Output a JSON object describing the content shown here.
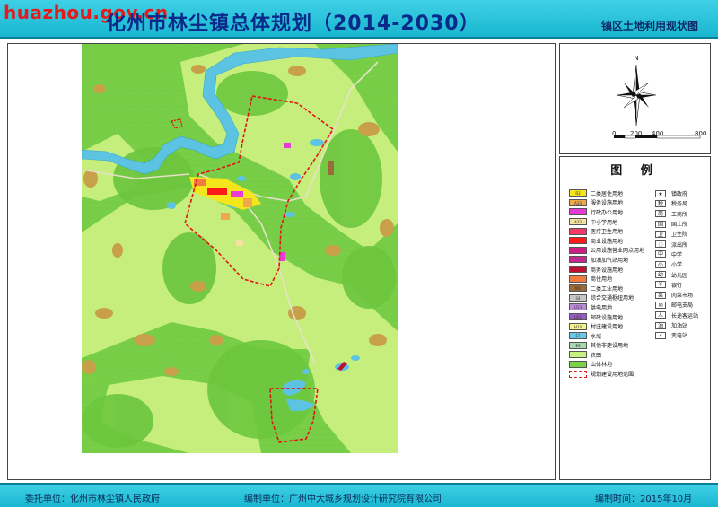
{
  "header": {
    "watermark": "huazhou.gov.cn",
    "title": "化州市林尘镇总体规划（2014-2030）",
    "subtitle": "镇区土地利用现状图"
  },
  "compass": {
    "north_label": "N",
    "scale": [
      "0",
      "200",
      "400",
      "800"
    ]
  },
  "legend": {
    "title": "图  例",
    "land_use": [
      {
        "code": "R2",
        "label": "二类居住用地",
        "color": "#f5e51b"
      },
      {
        "code": "A33",
        "label": "服务设施用地",
        "color": "#f0a94a"
      },
      {
        "code": "",
        "label": "行政办公用地",
        "color": "#e83ad8"
      },
      {
        "code": "A33",
        "label": "中小学用地",
        "color": "#f4e2a0"
      },
      {
        "code": "",
        "label": "医疗卫生用地",
        "color": "#f03a6b"
      },
      {
        "code": "",
        "label": "商业设施用地",
        "color": "#ff1a1a"
      },
      {
        "code": "",
        "label": "公用设施营业网点用地",
        "color": "#cc2080"
      },
      {
        "code": "",
        "label": "加油加气站用地",
        "color": "#c22a8e"
      },
      {
        "code": "",
        "label": "商务设施用地",
        "color": "#c01030"
      },
      {
        "code": "",
        "label": "商住用地",
        "color": "#f07a40"
      },
      {
        "code": "M2",
        "label": "二类工业用地",
        "color": "#9a6a3a"
      },
      {
        "code": "S4",
        "label": "综合交通枢纽用地",
        "color": "#c8c8c8"
      },
      {
        "code": "U13",
        "label": "供电用地",
        "color": "#b88ad8"
      },
      {
        "code": "U22",
        "label": "邮政设施用地",
        "color": "#9a5ac8"
      },
      {
        "code": "H14",
        "label": "村庄建设用地",
        "color": "#f3f38a"
      },
      {
        "code": "E1",
        "label": "水域",
        "color": "#6ac8e8"
      },
      {
        "code": "E9",
        "label": "其他非建设用地",
        "color": "#a8d8b0"
      },
      {
        "code": "",
        "label": "农田",
        "color": "#c8f080"
      },
      {
        "code": "",
        "label": "山体林地",
        "color": "#7ad24a"
      },
      {
        "code": "",
        "label": "规划建设用地范围",
        "color": "#ffffff"
      }
    ],
    "facilities": [
      {
        "glyph": "★",
        "label": "镇政府"
      },
      {
        "glyph": "税",
        "label": "税务局"
      },
      {
        "glyph": "商",
        "label": "工商所"
      },
      {
        "glyph": "国",
        "label": "国土所"
      },
      {
        "glyph": "卫",
        "label": "卫生院"
      },
      {
        "glyph": "◌",
        "label": "派出所"
      },
      {
        "glyph": "中",
        "label": "中学"
      },
      {
        "glyph": "小",
        "label": "小学"
      },
      {
        "glyph": "幼",
        "label": "幼儿园"
      },
      {
        "glyph": "￥",
        "label": "银行"
      },
      {
        "glyph": "菜",
        "label": "肉菜市场"
      },
      {
        "glyph": "✉",
        "label": "邮电支局"
      },
      {
        "glyph": "人",
        "label": "长途客运站"
      },
      {
        "glyph": "油",
        "label": "加油站"
      },
      {
        "glyph": "⚡",
        "label": "变电站"
      }
    ]
  },
  "footer": {
    "client": "委托单位：化州市林尘镇人民政府",
    "maker": "编制单位：广州中大城乡规划设计研究院有限公司",
    "date": "编制时间：2015年10月"
  }
}
